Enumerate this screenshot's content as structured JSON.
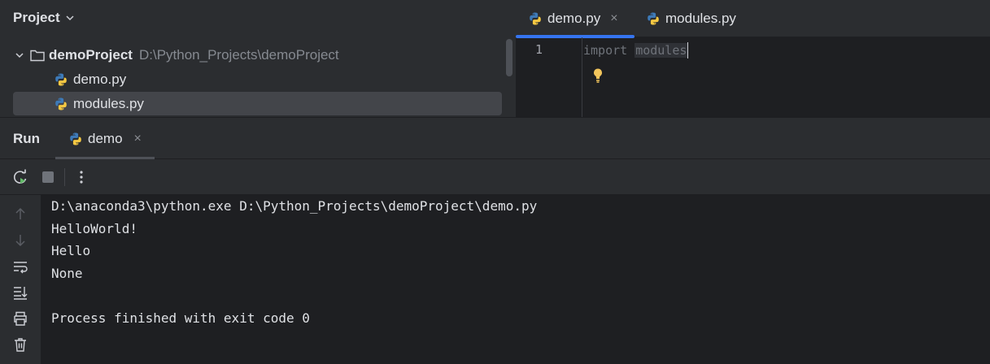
{
  "project_panel": {
    "title": "Project",
    "root": {
      "name": "demoProject",
      "path": "D:\\Python_Projects\\demoProject"
    },
    "files": [
      "demo.py",
      "modules.py"
    ]
  },
  "editor": {
    "tabs": [
      {
        "label": "demo.py",
        "close": "×"
      },
      {
        "label": "modules.py"
      }
    ],
    "line_number": "1",
    "code_keyword": "import",
    "code_module": "modules"
  },
  "run_panel": {
    "title": "Run",
    "tab_label": "demo",
    "tab_close": "×",
    "console_lines": [
      "D:\\anaconda3\\python.exe D:\\Python_Projects\\demoProject\\demo.py",
      "HelloWorld!",
      "Hello",
      "None",
      "",
      "Process finished with exit code 0"
    ]
  },
  "colors": {
    "accent": "#3574f0",
    "background": "#1e1f22",
    "panel": "#2b2d30"
  }
}
